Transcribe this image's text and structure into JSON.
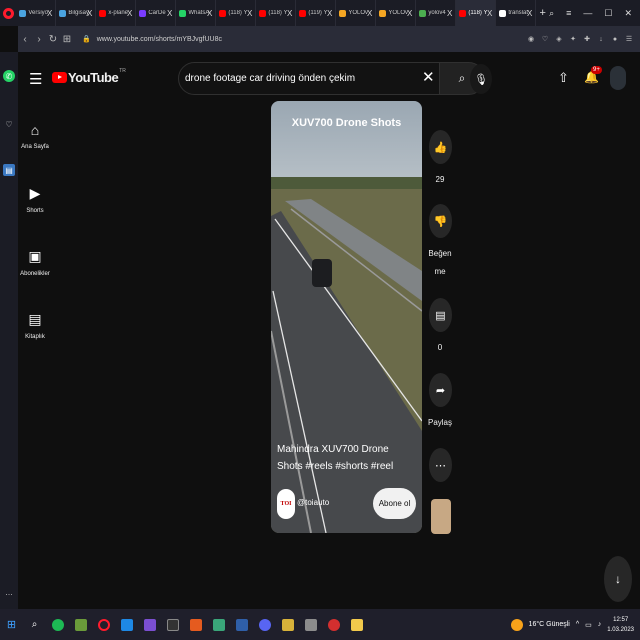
{
  "browser": {
    "tabs": [
      {
        "label": "Versiyo",
        "color": "#4aa3df",
        "active": false
      },
      {
        "label": "Bilgisay",
        "color": "#4aa3df",
        "active": false
      },
      {
        "label": "x-plane",
        "color": "#ff0000",
        "active": false
      },
      {
        "label": "CarDe",
        "color": "#7a3cff",
        "active": false
      },
      {
        "label": "WhatsA",
        "color": "#25d366",
        "active": false
      },
      {
        "label": "(118) Y",
        "color": "#ff0000",
        "active": false
      },
      {
        "label": "(118) Y",
        "color": "#ff0000",
        "active": false
      },
      {
        "label": "(119) Y",
        "color": "#ff0000",
        "active": false
      },
      {
        "label": "YOLOv",
        "color": "#f5a623",
        "active": false
      },
      {
        "label": "YOLOv",
        "color": "#f5a623",
        "active": false
      },
      {
        "label": "yolov4",
        "color": "#4caf50",
        "active": false
      },
      {
        "label": "(118) Y",
        "color": "#ff0000",
        "active": true
      },
      {
        "label": "translat",
        "color": "#ffffff",
        "active": false
      }
    ],
    "tab_close_glyph": "X",
    "new_tab_glyph": "+",
    "url": "www.youtube.com/shorts/mYBJvgfUU8c"
  },
  "youtube": {
    "logo_text": "YouTube",
    "country_code": "TR",
    "search_query": "drone footage car driving  önden çekim",
    "notification_count": "9+",
    "guide": [
      {
        "name": "home",
        "icon": "⌂",
        "label": "Ana Sayfa"
      },
      {
        "name": "shorts",
        "icon": "▶",
        "label": "Shorts"
      },
      {
        "name": "subscriptions",
        "icon": "▣",
        "label": "Abonelikler"
      },
      {
        "name": "library",
        "icon": "▤",
        "label": "Kitaplık"
      }
    ]
  },
  "short": {
    "overlay_title": "XUV700 Drone Shots",
    "caption": "Mahindra XUV700 Drone Shots #reels #shorts #reel",
    "channel_handle": "@toiauto",
    "channel_avatar_text": "TOI",
    "subscribe_label": "Abone ol",
    "likes": "29",
    "dislike_label_line1": "Beğen",
    "dislike_label_line2": "me",
    "comments": "0",
    "share_label": "Paylaş"
  },
  "taskbar": {
    "weather": "16°C  Güneşli",
    "time": "12:57",
    "date": "1.03.2023"
  },
  "colors": {
    "youtube_red": "#ff0000",
    "background": "#0f0f0f",
    "opera_red": "#ff1b2d"
  }
}
